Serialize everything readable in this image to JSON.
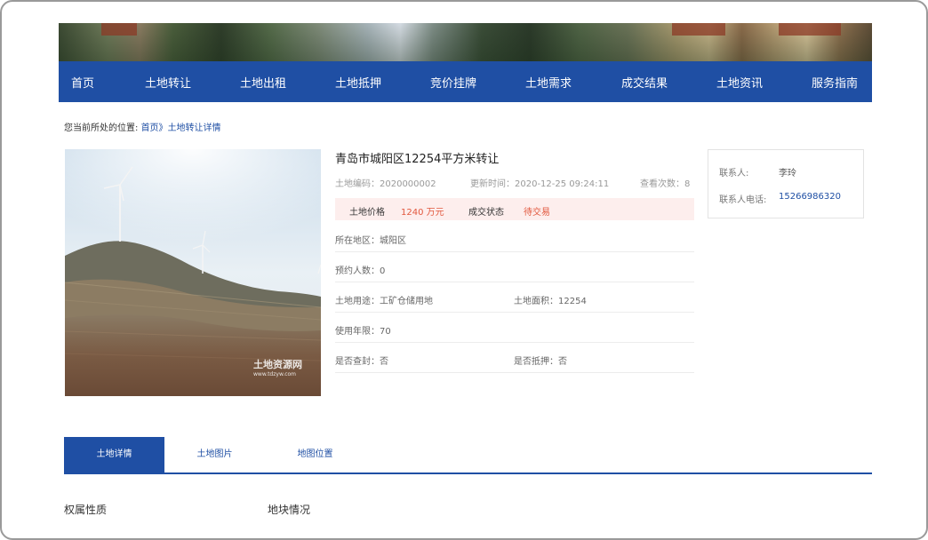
{
  "nav": {
    "items": [
      {
        "label": "首页"
      },
      {
        "label": "土地转让"
      },
      {
        "label": "土地出租"
      },
      {
        "label": "土地抵押"
      },
      {
        "label": "竞价挂牌"
      },
      {
        "label": "土地需求"
      },
      {
        "label": "成交结果"
      },
      {
        "label": "土地资讯"
      },
      {
        "label": "服务指南"
      }
    ]
  },
  "breadcrumb": {
    "prefix": "您当前所处的位置:",
    "home": "首页》",
    "current": "土地转让详情"
  },
  "photo": {
    "watermark_main": "土地资源网",
    "watermark_sub": "www.tdzyw.com"
  },
  "listing": {
    "title": "青岛市城阳区12254平方米转让",
    "code": "土地编码：2020000002",
    "updated": "更新时间：2020-12-25 09:24:11",
    "views": "查看次数：8",
    "price_label": "土地价格",
    "price_value": "1240 万元",
    "status_label": "成交状态",
    "status_value": "待交易",
    "region": "所在地区：城阳区",
    "reservations": "预约人数：0",
    "usage": "土地用途：工矿仓储用地",
    "area": "土地面积：12254",
    "term": "使用年限：70",
    "sealed": "是否查封：否",
    "mortgaged": "是否抵押：否"
  },
  "contact": {
    "person_label": "联系人:",
    "person_value": "李玲",
    "phone_label": "联系人电话:",
    "phone_value": "15266986320"
  },
  "tabs": [
    {
      "label": "土地详情"
    },
    {
      "label": "土地图片"
    },
    {
      "label": "地图位置"
    }
  ],
  "sections": {
    "ownership": "权属性质",
    "plot": "地块情况"
  },
  "colors": {
    "brand_blue": "#1f4fa4",
    "price_red": "#e2583e",
    "price_bar_bg": "#fdeeed"
  }
}
